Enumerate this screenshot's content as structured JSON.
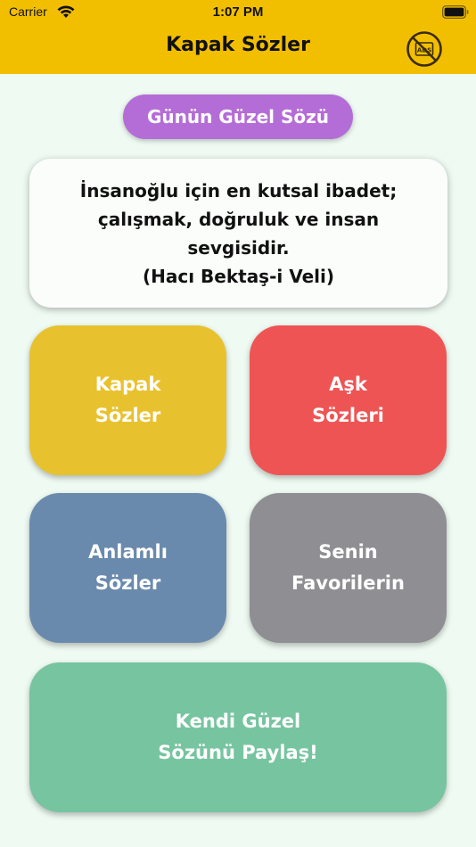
{
  "status_bar": {
    "carrier": "Carrier",
    "time": "1:07 PM",
    "wifi_icon": "wifi-icon",
    "battery_icon": "battery-icon"
  },
  "nav": {
    "title": "Kapak Sözler",
    "no_ads_icon": "no-ads-icon",
    "no_ads_label": "ADS"
  },
  "daily": {
    "pill_label": "Günün Güzel Sözü",
    "quote_text": "İnsanoğlu için en kutsal ibadet; çalışmak, doğruluk ve insan sevgisidir.",
    "quote_author": "(Hacı Bektaş-i Veli)"
  },
  "tiles": [
    {
      "line1": "Kapak",
      "line2": "Sözler",
      "color": "#e8c22e"
    },
    {
      "line1": "Aşk",
      "line2": "Sözleri",
      "color": "#ef5454"
    },
    {
      "line1": "Anlamlı",
      "line2": "Sözler",
      "color": "#6a8aad"
    },
    {
      "line1": "Senin",
      "line2": "Favorilerin",
      "color": "#8e8e93"
    },
    {
      "line1": "Kendi Güzel",
      "line2": "Sözünü Paylaş!",
      "color": "#77c4a0"
    }
  ],
  "colors": {
    "header": "#f2bf00",
    "background": "#eefaf2",
    "pill": "#b46dd6"
  }
}
